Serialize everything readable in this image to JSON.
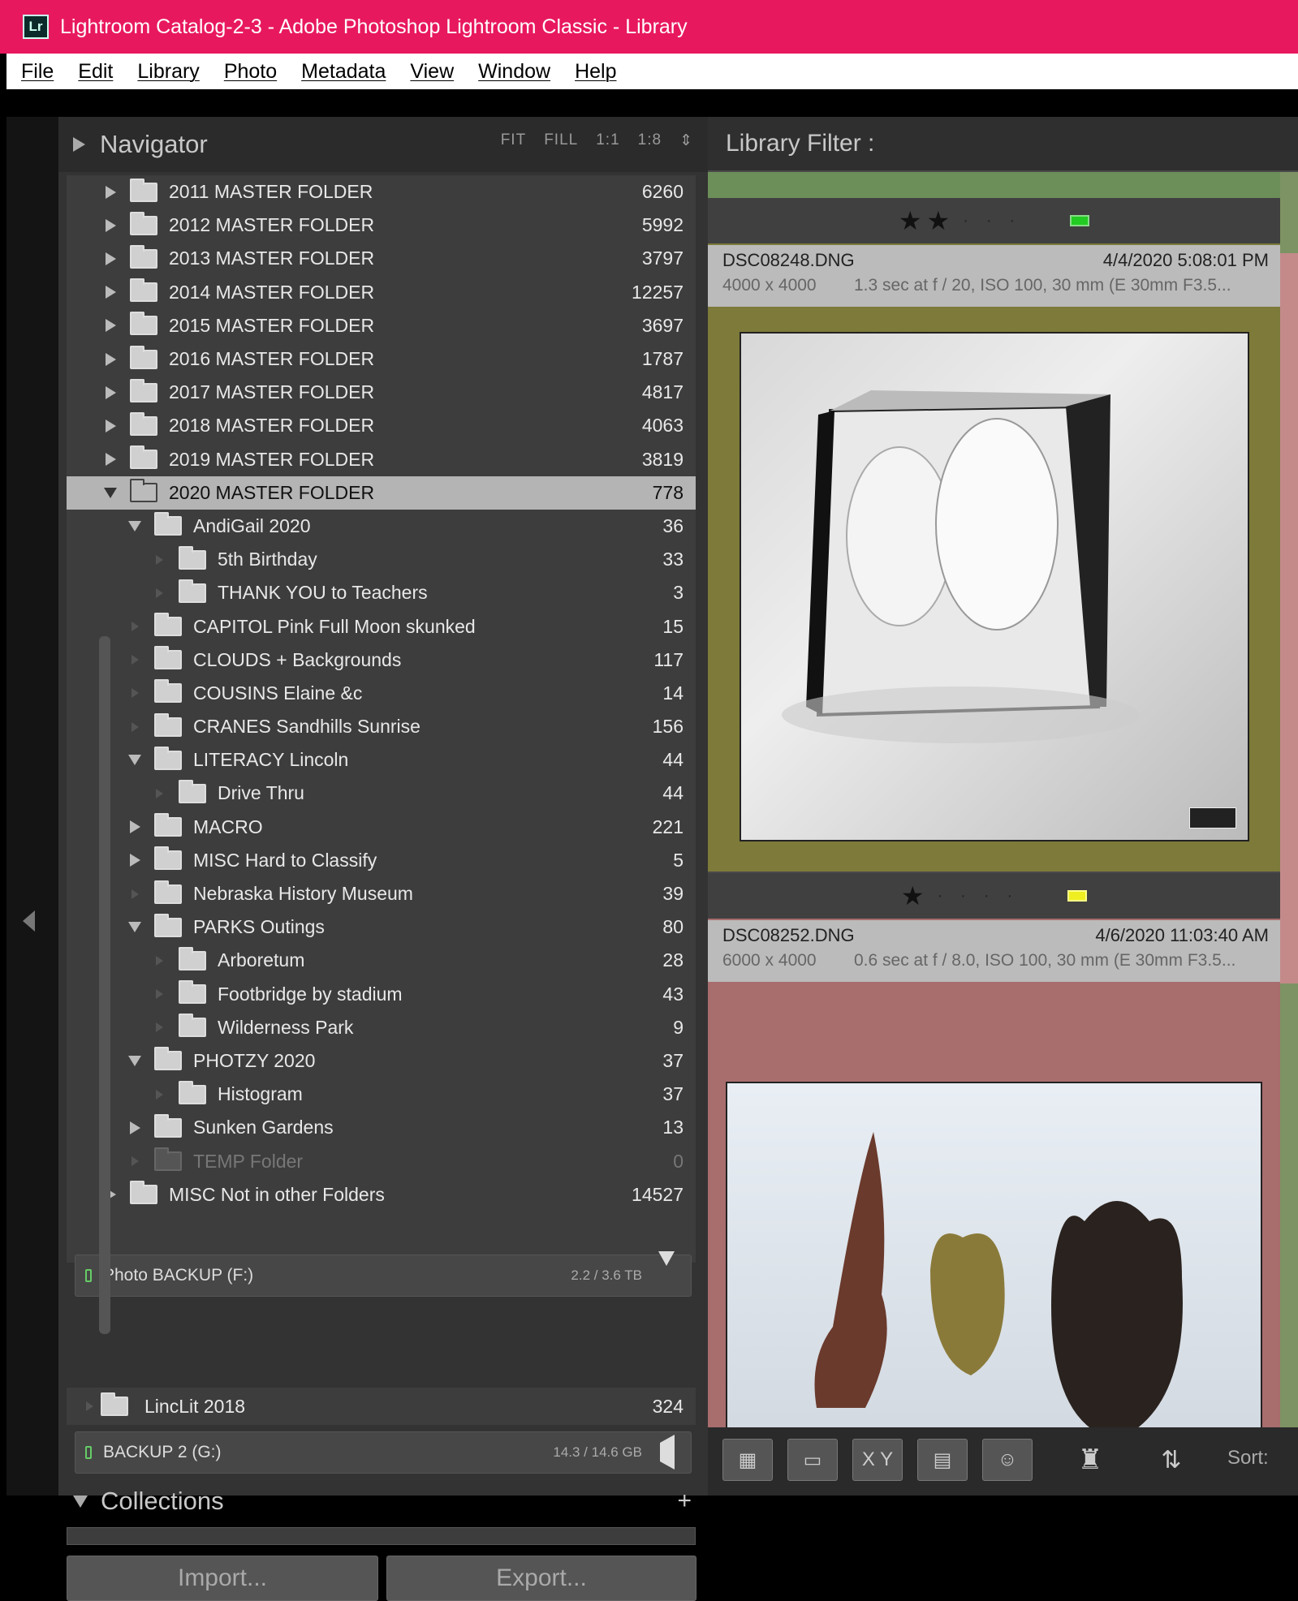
{
  "window": {
    "app_badge": "Lr",
    "title": "Lightroom Catalog-2-3 - Adobe Photoshop Lightroom Classic - Library"
  },
  "menu": [
    "File",
    "Edit",
    "Library",
    "Photo",
    "Metadata",
    "View",
    "Window",
    "Help"
  ],
  "navigator": {
    "title": "Navigator",
    "zoom_options": [
      "FIT",
      "FILL",
      "1:1",
      "1:8"
    ]
  },
  "folders": [
    {
      "name": "2011 MASTER FOLDER",
      "count": "6260",
      "level": 0,
      "arrow": "right"
    },
    {
      "name": "2012 MASTER FOLDER",
      "count": "5992",
      "level": 0,
      "arrow": "right"
    },
    {
      "name": "2013 MASTER FOLDER",
      "count": "3797",
      "level": 0,
      "arrow": "right"
    },
    {
      "name": "2014 MASTER FOLDER",
      "count": "12257",
      "level": 0,
      "arrow": "right"
    },
    {
      "name": "2015 MASTER FOLDER",
      "count": "3697",
      "level": 0,
      "arrow": "right"
    },
    {
      "name": "2016 MASTER FOLDER",
      "count": "1787",
      "level": 0,
      "arrow": "right"
    },
    {
      "name": "2017 MASTER FOLDER",
      "count": "4817",
      "level": 0,
      "arrow": "right"
    },
    {
      "name": "2018 MASTER FOLDER",
      "count": "4063",
      "level": 0,
      "arrow": "right"
    },
    {
      "name": "2019 MASTER FOLDER",
      "count": "3819",
      "level": 0,
      "arrow": "right"
    },
    {
      "name": "2020 MASTER FOLDER",
      "count": "778",
      "level": 0,
      "arrow": "down",
      "selected": true
    },
    {
      "name": "AndiGail 2020",
      "count": "36",
      "level": 1,
      "arrow": "down"
    },
    {
      "name": "5th Birthday",
      "count": "33",
      "level": 2,
      "arrow": "none"
    },
    {
      "name": "THANK YOU to Teachers",
      "count": "3",
      "level": 2,
      "arrow": "none"
    },
    {
      "name": "CAPITOL Pink Full Moon skunked",
      "count": "15",
      "level": 1,
      "arrow": "none"
    },
    {
      "name": "CLOUDS + Backgrounds",
      "count": "117",
      "level": 1,
      "arrow": "none"
    },
    {
      "name": "COUSINS Elaine &c",
      "count": "14",
      "level": 1,
      "arrow": "none"
    },
    {
      "name": "CRANES Sandhills Sunrise",
      "count": "156",
      "level": 1,
      "arrow": "none"
    },
    {
      "name": "LITERACY Lincoln",
      "count": "44",
      "level": 1,
      "arrow": "down"
    },
    {
      "name": "Drive Thru",
      "count": "44",
      "level": 2,
      "arrow": "none"
    },
    {
      "name": "MACRO",
      "count": "221",
      "level": 1,
      "arrow": "right"
    },
    {
      "name": "MISC Hard to Classify",
      "count": "5",
      "level": 1,
      "arrow": "right"
    },
    {
      "name": "Nebraska History Museum",
      "count": "39",
      "level": 1,
      "arrow": "none"
    },
    {
      "name": "PARKS Outings",
      "count": "80",
      "level": 1,
      "arrow": "down"
    },
    {
      "name": "Arboretum",
      "count": "28",
      "level": 2,
      "arrow": "none"
    },
    {
      "name": "Footbridge by stadium",
      "count": "43",
      "level": 2,
      "arrow": "none"
    },
    {
      "name": "Wilderness Park",
      "count": "9",
      "level": 2,
      "arrow": "none"
    },
    {
      "name": "PHOTZY 2020",
      "count": "37",
      "level": 1,
      "arrow": "down"
    },
    {
      "name": "Histogram",
      "count": "37",
      "level": 2,
      "arrow": "none"
    },
    {
      "name": "Sunken Gardens",
      "count": "13",
      "level": 1,
      "arrow": "right"
    },
    {
      "name": "TEMP Folder",
      "count": "0",
      "level": 1,
      "arrow": "none",
      "dim": true
    },
    {
      "name": "MISC Not in other Folders",
      "count": "14527",
      "level": 0,
      "arrow": "right"
    }
  ],
  "drives": {
    "photo_backup": {
      "name": "Photo BACKUP (F:)",
      "size": "2.2 / 3.6 TB"
    },
    "linclit": {
      "name": "LincLit 2018",
      "count": "324"
    },
    "backup2": {
      "name": "BACKUP 2 (G:)",
      "size": "14.3 / 14.6 GB"
    }
  },
  "collections": {
    "title": "Collections",
    "add": "+"
  },
  "buttons": {
    "import": "Import...",
    "export": "Export..."
  },
  "library_filter": {
    "label": "Library Filter :"
  },
  "photos": [
    {
      "filename": "DSC08248.DNG",
      "date": "4/4/2020 5:08:01 PM",
      "dimensions": "4000 x 4000",
      "exif": "1.3 sec at f / 20, ISO 100, 30 mm (E 30mm F3.5...",
      "stars": "★★",
      "rating": 2,
      "label_color": "#22cc22"
    },
    {
      "filename": "DSC08252.DNG",
      "date": "4/6/2020 11:03:40 AM",
      "dimensions": "6000 x 4000",
      "exif": "0.6 sec at f / 8.0, ISO 100, 30 mm (E 30mm F3.5...",
      "stars": "★",
      "rating": 1,
      "label_color": "#eeee22"
    }
  ],
  "toolbar": {
    "sort_label": "Sort:",
    "xy": "X Y"
  }
}
